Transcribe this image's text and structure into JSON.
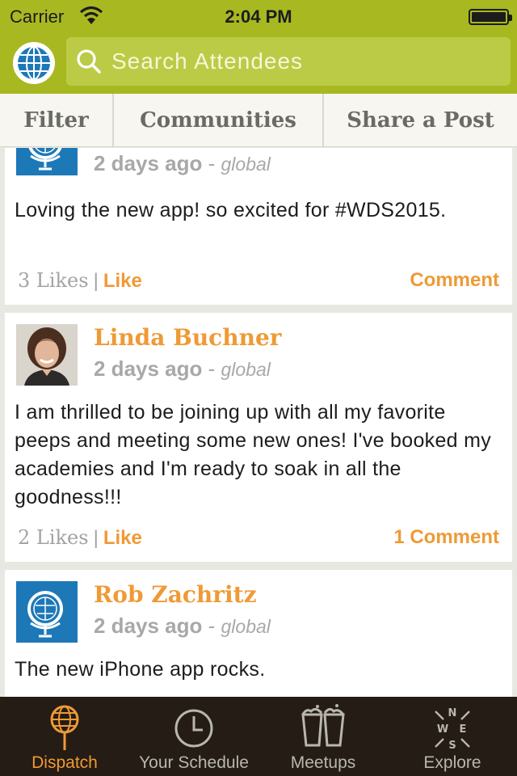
{
  "status_bar": {
    "carrier": "Carrier",
    "time": "2:04 PM"
  },
  "search": {
    "placeholder": "Search Attendees"
  },
  "segments": [
    "Filter",
    "Communities",
    "Share a Post"
  ],
  "posts": [
    {
      "author": "",
      "avatar_icon": "globe-logo-icon",
      "time_ago": "2 days ago",
      "separator": " - ",
      "scope": "global",
      "body": "Loving the new app! so excited for #WDS2015.",
      "likes": "3 Likes",
      "like_label": "Like",
      "comment_label": "Comment"
    },
    {
      "author": "Linda Buchner",
      "avatar_icon": "user-photo",
      "time_ago": "2 days ago",
      "separator": " - ",
      "scope": "global",
      "body": "I am thrilled to be joining up with all my favorite peeps and meeting some new ones! I've booked my academies and I'm ready to soak in all the goodness!!!",
      "likes": "2 Likes",
      "like_label": "Like",
      "comment_label": "1 Comment"
    },
    {
      "author": "Rob Zachritz",
      "avatar_icon": "globe-logo-icon",
      "time_ago": "2 days ago",
      "separator": " - ",
      "scope": "global",
      "body": "The new iPhone app rocks."
    }
  ],
  "tabs": [
    {
      "label": "Dispatch",
      "icon": "dispatch-icon",
      "active": true
    },
    {
      "label": "Your Schedule",
      "icon": "clock-icon",
      "active": false
    },
    {
      "label": "Meetups",
      "icon": "cups-icon",
      "active": false
    },
    {
      "label": "Explore",
      "icon": "compass-icon",
      "active": false
    }
  ],
  "compass_letters": {
    "n": "N",
    "w": "W",
    "e": "E",
    "s": "S"
  },
  "colors": {
    "header": "#a8b820",
    "search_field": "#bccb45",
    "accent_orange": "#ef9a35",
    "tabbar": "#241c15",
    "globe_blue": "#1d78b8"
  }
}
